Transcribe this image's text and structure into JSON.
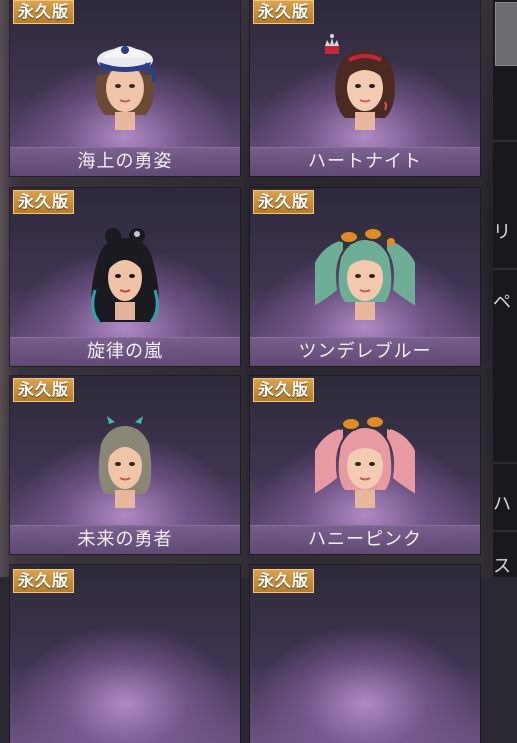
{
  "badge_label": "永久版",
  "cards": [
    {
      "name": "海上の勇姿",
      "hair_color": "#6b4a35",
      "hat": "sailor-cap-icon"
    },
    {
      "name": "ハートナイト",
      "hair_color": "#4a2a22",
      "hat": "tiara-icon"
    },
    {
      "name": "旋律の嵐",
      "hair_color": "#1a1a20",
      "accent": "#2fa3a8"
    },
    {
      "name": "ツンデレブルー",
      "hair_color": "#6fae96",
      "accent": "#e08a2a"
    },
    {
      "name": "未来の勇者",
      "hair_color": "#8a8678",
      "accent": "#3fb8b0"
    },
    {
      "name": "ハニーピンク",
      "hair_color": "#e89aa2",
      "accent": "#e08a2a"
    }
  ],
  "partial_cards": [
    {
      "badge": "永久版"
    },
    {
      "badge": "永久版"
    }
  ],
  "side_panel": {
    "tabs": [
      "リ",
      "ペ",
      "ハ",
      "ス"
    ]
  },
  "colors": {
    "badge": "#c68e3a",
    "name_bar": "#6e5286",
    "card_glow": "#b48ccb"
  }
}
